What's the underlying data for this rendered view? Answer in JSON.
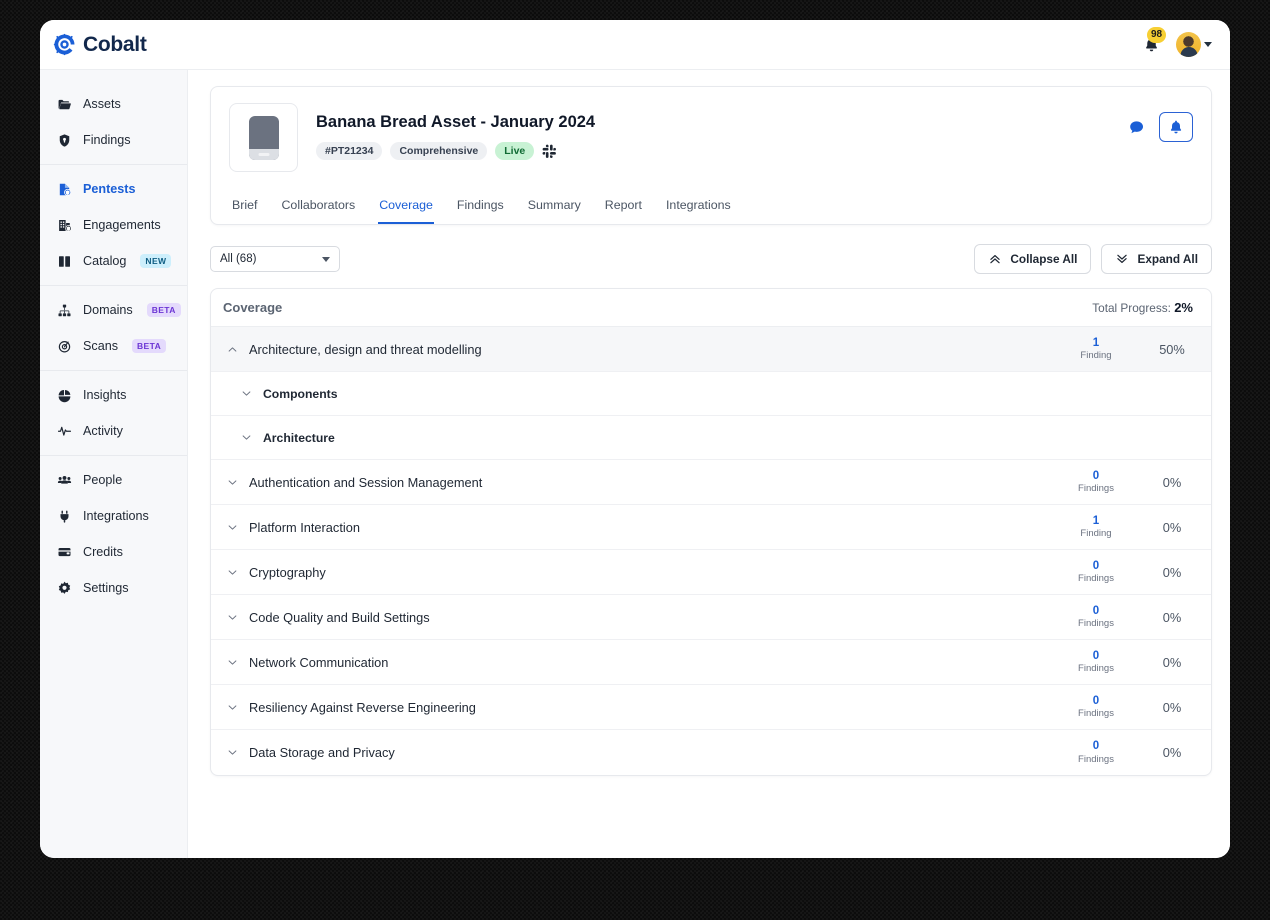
{
  "brand": {
    "name": "Cobalt",
    "logo_icon": "cobalt-logo-icon"
  },
  "topbar": {
    "bell_icon": "bell-icon",
    "notification_count": "98",
    "avatar_icon": "user-avatar",
    "caret_icon": "chevron-down-icon"
  },
  "sidebar": {
    "groups": [
      {
        "items": [
          {
            "label": "Assets",
            "icon": "folder-icon",
            "active": false,
            "tag": ""
          },
          {
            "label": "Findings",
            "icon": "shield-icon",
            "active": false,
            "tag": ""
          }
        ]
      },
      {
        "items": [
          {
            "label": "Pentests",
            "icon": "pentest-file-icon",
            "active": true,
            "tag": ""
          },
          {
            "label": "Engagements",
            "icon": "engagements-icon",
            "active": false,
            "tag": ""
          },
          {
            "label": "Catalog",
            "icon": "book-icon",
            "active": false,
            "tag": "NEW"
          }
        ]
      },
      {
        "items": [
          {
            "label": "Domains",
            "icon": "sitemap-icon",
            "active": false,
            "tag": "BETA"
          },
          {
            "label": "Scans",
            "icon": "scan-target-icon",
            "active": false,
            "tag": "BETA"
          }
        ]
      },
      {
        "items": [
          {
            "label": "Insights",
            "icon": "pie-chart-icon",
            "active": false,
            "tag": ""
          },
          {
            "label": "Activity",
            "icon": "activity-pulse-icon",
            "active": false,
            "tag": ""
          }
        ]
      },
      {
        "items": [
          {
            "label": "People",
            "icon": "people-icon",
            "active": false,
            "tag": ""
          },
          {
            "label": "Integrations",
            "icon": "plug-icon",
            "active": false,
            "tag": ""
          },
          {
            "label": "Credits",
            "icon": "wallet-icon",
            "active": false,
            "tag": ""
          },
          {
            "label": "Settings",
            "icon": "gear-icon",
            "active": false,
            "tag": ""
          }
        ]
      }
    ]
  },
  "asset": {
    "thumbnail_icon": "mobile-phone-icon",
    "title": "Banana Bread Asset - January 2024",
    "badges": [
      {
        "text": "#PT21234",
        "style": "gray"
      },
      {
        "text": "Comprehensive",
        "style": "gray"
      },
      {
        "text": "Live",
        "style": "green"
      }
    ],
    "slack_icon": "slack-icon",
    "comment_icon": "comment-icon",
    "bell_button_icon": "bell-icon",
    "tabs": [
      {
        "label": "Brief",
        "active": false
      },
      {
        "label": "Collaborators",
        "active": false
      },
      {
        "label": "Coverage",
        "active": true
      },
      {
        "label": "Findings",
        "active": false
      },
      {
        "label": "Summary",
        "active": false
      },
      {
        "label": "Report",
        "active": false
      },
      {
        "label": "Integrations",
        "active": false
      }
    ]
  },
  "toolbar": {
    "filter_value": "All (68)",
    "filter_caret_icon": "chevron-down-icon",
    "collapse_label": "Collapse All",
    "collapse_icon": "double-chevron-up-icon",
    "expand_label": "Expand All",
    "expand_icon": "double-chevron-down-icon"
  },
  "coverage": {
    "header_title": "Coverage",
    "total_progress_label": "Total Progress:",
    "total_progress_value": "2%",
    "rows": [
      {
        "label": "Architecture, design and threat modelling",
        "findings": "1",
        "findings_label": "Finding",
        "percent": "50%",
        "expanded": true,
        "sub": false
      },
      {
        "label": "Components",
        "findings": "",
        "findings_label": "",
        "percent": "",
        "expanded": false,
        "sub": true
      },
      {
        "label": "Architecture",
        "findings": "",
        "findings_label": "",
        "percent": "",
        "expanded": false,
        "sub": true
      },
      {
        "label": "Authentication and Session Management",
        "findings": "0",
        "findings_label": "Findings",
        "percent": "0%",
        "expanded": false,
        "sub": false
      },
      {
        "label": "Platform Interaction",
        "findings": "1",
        "findings_label": "Finding",
        "percent": "0%",
        "expanded": false,
        "sub": false
      },
      {
        "label": "Cryptography",
        "findings": "0",
        "findings_label": "Findings",
        "percent": "0%",
        "expanded": false,
        "sub": false
      },
      {
        "label": "Code Quality and Build Settings",
        "findings": "0",
        "findings_label": "Findings",
        "percent": "0%",
        "expanded": false,
        "sub": false
      },
      {
        "label": "Network Communication",
        "findings": "0",
        "findings_label": "Findings",
        "percent": "0%",
        "expanded": false,
        "sub": false
      },
      {
        "label": "Resiliency Against Reverse Engineering",
        "findings": "0",
        "findings_label": "Findings",
        "percent": "0%",
        "expanded": false,
        "sub": false
      },
      {
        "label": "Data Storage and Privacy",
        "findings": "0",
        "findings_label": "Findings",
        "percent": "0%",
        "expanded": false,
        "sub": false
      }
    ]
  },
  "colors": {
    "accent_blue": "#1b5fd6",
    "brand_navy": "#12284c",
    "badge_green_bg": "#c8f2d4",
    "badge_new_bg": "#cdeffc",
    "badge_beta_bg": "#e4dafc",
    "notification_yellow": "#f7cf33"
  }
}
